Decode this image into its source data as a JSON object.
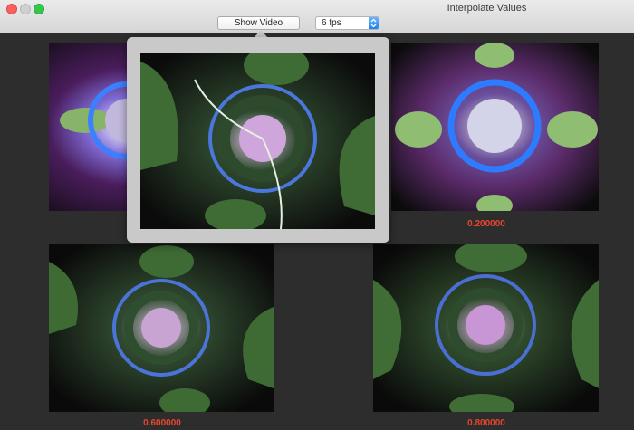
{
  "window": {
    "title": "Interpolate Values"
  },
  "toolbar": {
    "show_video_label": "Show Video",
    "fps": {
      "selected": "6 fps"
    }
  },
  "thumbnails": [
    {
      "caption": ""
    },
    {
      "caption": "0.200000"
    },
    {
      "caption": "0.600000"
    },
    {
      "caption": "0.800000"
    }
  ],
  "colors": {
    "caption_text": "#e8462e",
    "background": "#2d2d2d"
  }
}
